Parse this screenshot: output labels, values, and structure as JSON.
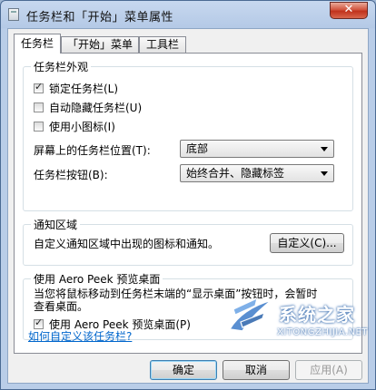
{
  "window": {
    "title": "任务栏和「开始」菜单属性",
    "close_label": "✕"
  },
  "tabs": [
    {
      "label": "任务栏",
      "active": true
    },
    {
      "label": "「开始」菜单",
      "active": false
    },
    {
      "label": "工具栏",
      "active": false
    }
  ],
  "appearance": {
    "legend": "任务栏外观",
    "lock": {
      "label": "锁定任务栏(L)",
      "checked": true
    },
    "autohide": {
      "label": "自动隐藏任务栏(U)",
      "checked": false
    },
    "small_icons": {
      "label": "使用小图标(I)",
      "checked": false
    },
    "position_label": "屏幕上的任务栏位置(T):",
    "position_value": "底部",
    "buttons_label": "任务栏按钮(B):",
    "buttons_value": "始终合并、隐藏标签"
  },
  "notification": {
    "legend": "通知区域",
    "desc": "自定义通知区域中出现的图标和通知。",
    "customize_button": "自定义(C)..."
  },
  "aero_peek": {
    "legend": "使用 Aero Peek 预览桌面",
    "desc_line1": "当您将鼠标移动到任务栏末端的“显示桌面”按钮时，会暂时",
    "desc_line2": "查看桌面。",
    "check": {
      "label": "使用 Aero Peek 预览桌面(P)",
      "checked": true
    }
  },
  "help_link": "如何自定义该任务栏?",
  "footer": {
    "ok": "确定",
    "cancel": "取消",
    "apply": "应用(A)"
  },
  "watermark": {
    "main": "系统之家",
    "sub": "XITONGZHIJIA.NET"
  },
  "colors": {
    "accent": "#3c7fb1",
    "link": "#0066cc",
    "close": "#c0321c"
  }
}
